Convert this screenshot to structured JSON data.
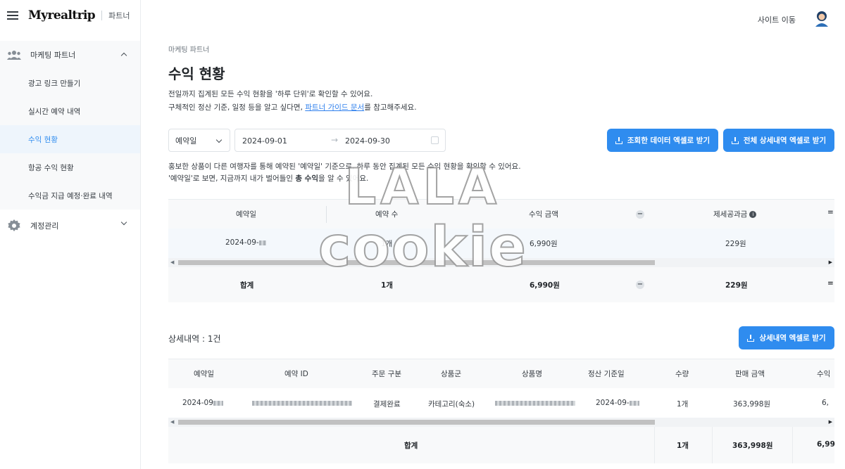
{
  "sidebar": {
    "logo": "Myrealtrip",
    "logo_sub": "파트너",
    "group1": "마케팅 파트너",
    "items": [
      "광고 링크 만들기",
      "실시간 예약 내역",
      "수익 현황",
      "항공 수익 현황",
      "수익금 지급 예정·완료 내역"
    ],
    "group2": "계정관리"
  },
  "header": {
    "site_move": "사이트 이동"
  },
  "page": {
    "breadcrumb": "마케팅 파트너",
    "title": "수익 현황",
    "desc1": "전일까지 집계된 모든 수익 현황을 '하루 단위'로 확인할 수 있어요.",
    "desc2_pre": "구체적인 정산 기준, 일정 등을 알고 싶다면, ",
    "desc2_link": "파트너 가이드 문서",
    "desc2_post": "를 참고해주세요."
  },
  "filter": {
    "date_type": "예약일",
    "start": "2024-09-01",
    "end": "2024-09-30",
    "btn_export": "조회한 데이터 엑셀로 받기",
    "btn_export_all": "전체 상세내역 엑셀로 받기"
  },
  "note": {
    "line1": "홍보한 상품이 다른 여행자를 통해 예약된 '예약일' 기준으로, 하루 동안 집계된 모든 수익 현황을 확인할 수 있어요.",
    "line2_pre": "'예약일'로 보면, 지금까지 내가 벌어들인 ",
    "line2_bold": "총 수익",
    "line2_post": "을 알 수 있어요."
  },
  "summary": {
    "headers": [
      "예약일",
      "예약 수",
      "수익 금액",
      "제세공과금"
    ],
    "row": [
      "2024-09-",
      "1개",
      "6,990원",
      "229원"
    ],
    "total_label": "합계",
    "total": [
      "1개",
      "6,990원",
      "229원"
    ],
    "minus": "−",
    "equals": "="
  },
  "detail": {
    "title": "상세내역 : 1건",
    "btn": "상세내역 엑셀로 받기",
    "headers": [
      "예약일",
      "예약 ID",
      "주문 구분",
      "상품군",
      "상품명",
      "정산 기준일",
      "수량",
      "판매 금액",
      "수익"
    ],
    "row": [
      "2024-09",
      "",
      "결제완료",
      "카테고리(숙소)",
      "",
      "2024-09-",
      "1개",
      "363,998원",
      "6,"
    ],
    "total_label": "합계",
    "total": [
      "1개",
      "363,998원",
      "6,99"
    ]
  },
  "watermark": {
    "line1": "LALA",
    "line2": "cookie"
  },
  "colors": {
    "accent": "#2f8cef",
    "link": "#2f80ed"
  },
  "icons": [
    "menu-icon",
    "people-icon",
    "gear-icon",
    "download-icon",
    "calendar-icon",
    "info-icon",
    "avatar"
  ]
}
